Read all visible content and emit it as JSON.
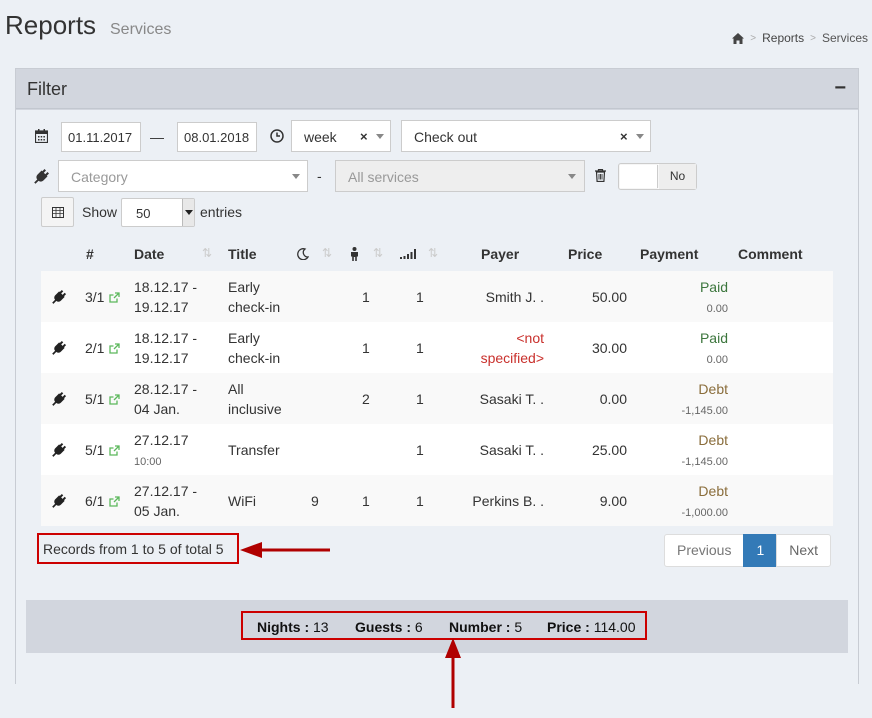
{
  "header": {
    "title": "Reports",
    "subtitle": "Services",
    "breadcrumb": [
      "Reports",
      "Services"
    ]
  },
  "filter": {
    "title": "Filter",
    "collapse": "−",
    "date_from": "01.11.2017",
    "date_dash": "—",
    "date_to": "08.01.2018",
    "period": "week",
    "clear": "×",
    "mode": "Check out",
    "category_placeholder": "Category",
    "dash": "-",
    "services_placeholder": "All services",
    "toggle_label": "No"
  },
  "length": {
    "show": "Show",
    "value": "50",
    "entries": "entries"
  },
  "table": {
    "headers": {
      "num": "#",
      "date": "Date",
      "title": "Title",
      "payer": "Payer",
      "price": "Price",
      "payment": "Payment",
      "comment": "Comment"
    },
    "rows": [
      {
        "num": "3/1",
        "date1": "18.12.17 -",
        "date2": "19.12.17",
        "title1": "Early",
        "title2": "check-in",
        "nights": "",
        "guests": "1",
        "number": "1",
        "payer1": "Smith J. .",
        "payer2": "",
        "price": "50.00",
        "status": "Paid",
        "amount": "0.00",
        "kind": "paid"
      },
      {
        "num": "2/1",
        "date1": "18.12.17 -",
        "date2": "19.12.17",
        "title1": "Early",
        "title2": "check-in",
        "nights": "",
        "guests": "1",
        "number": "1",
        "payer1": "<not",
        "payer2": "specified>",
        "price": "30.00",
        "status": "Paid",
        "amount": "0.00",
        "kind": "paid"
      },
      {
        "num": "5/1",
        "date1": "28.12.17 -",
        "date2": "04 Jan.",
        "title1": "All",
        "title2": "inclusive",
        "nights": "",
        "guests": "2",
        "number": "1",
        "payer1": "Sasaki T. .",
        "payer2": "",
        "price": "0.00",
        "status": "Debt",
        "amount": "-1,145.00",
        "kind": "debt"
      },
      {
        "num": "5/1",
        "date1": "27.12.17",
        "date2": "10:00",
        "title1": "Transfer",
        "title2": "",
        "nights": "",
        "guests": "",
        "number": "1",
        "payer1": "Sasaki T. .",
        "payer2": "",
        "price": "25.00",
        "status": "Debt",
        "amount": "-1,145.00",
        "kind": "debt"
      },
      {
        "num": "6/1",
        "date1": "27.12.17 -",
        "date2": "05 Jan.",
        "title1": "WiFi",
        "title2": "",
        "nights": "9",
        "guests": "1",
        "number": "1",
        "payer1": "Perkins B. .",
        "payer2": "",
        "price": "9.00",
        "status": "Debt",
        "amount": "-1,000.00",
        "kind": "debt"
      }
    ]
  },
  "records_info": "Records from 1 to 5 of total 5",
  "pagination": {
    "previous": "Previous",
    "page": "1",
    "next": "Next"
  },
  "totals": {
    "nights_label": "Nights :",
    "nights": "13",
    "guests_label": "Guests :",
    "guests": "6",
    "number_label": "Number :",
    "number": "5",
    "price_label": "Price :",
    "price": "114.00"
  },
  "colors": {
    "accent": "#337ab7",
    "paid": "#3c763d",
    "debt": "#8a6d3b",
    "annotation": "#c00000"
  }
}
